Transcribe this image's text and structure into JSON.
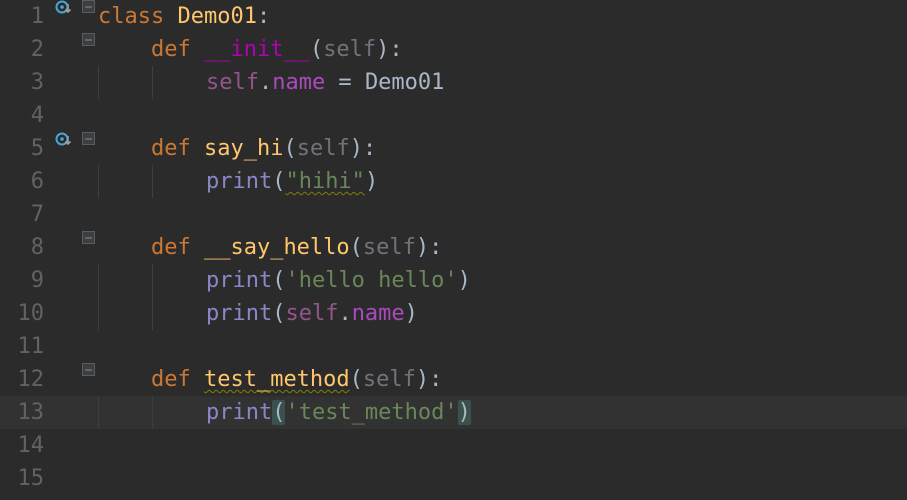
{
  "lines": {
    "1": {
      "num": "1"
    },
    "2": {
      "num": "2"
    },
    "3": {
      "num": "3"
    },
    "4": {
      "num": "4"
    },
    "5": {
      "num": "5"
    },
    "6": {
      "num": "6"
    },
    "7": {
      "num": "7"
    },
    "8": {
      "num": "8"
    },
    "9": {
      "num": "9"
    },
    "10": {
      "num": "10"
    },
    "11": {
      "num": "11"
    },
    "12": {
      "num": "12"
    },
    "13": {
      "num": "13"
    },
    "14": {
      "num": "14"
    },
    "15": {
      "num": "15"
    }
  },
  "code": {
    "kw_class": "class ",
    "class_name": "Demo01",
    "colon": ":",
    "kw_def": "def ",
    "fn_init": "__init__",
    "lp": "(",
    "rp": ")",
    "self": "self",
    "self_dot": "self",
    "dot": ".",
    "attr_name": "name",
    "assign": " = ",
    "demo01": "Demo01",
    "fn_sayhi": "say_hi",
    "print": "print",
    "str_hihi": "\"hihi\"",
    "fn_sayhello": "__say_hello",
    "str_hello": "'hello hello'",
    "fn_test": "test_method",
    "str_test": "'test_method'"
  },
  "indent": {
    "i4": "    ",
    "i8": "        "
  }
}
